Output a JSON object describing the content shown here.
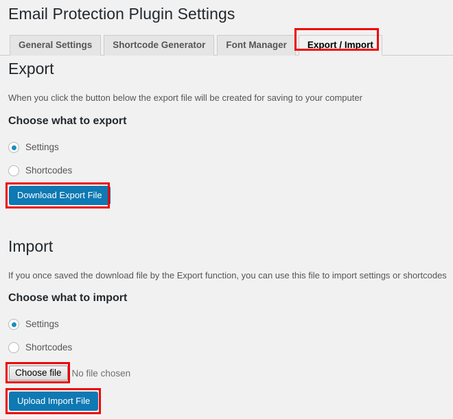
{
  "page": {
    "title": "Email Protection Plugin Settings",
    "background_color": "#f1f1f1"
  },
  "tabs": {
    "items": [
      {
        "label": "General Settings",
        "active": false
      },
      {
        "label": "Shortcode Generator",
        "active": false
      },
      {
        "label": "Font Manager",
        "active": false
      },
      {
        "label": "Export / Import",
        "active": true
      }
    ]
  },
  "export": {
    "heading": "Export",
    "description": "When you click the button below the export file will be created for saving to your computer",
    "subheading": "Choose what to export",
    "options": [
      {
        "label": "Settings",
        "selected": true
      },
      {
        "label": "Shortcodes",
        "selected": false
      }
    ],
    "download_button_label": "Download Export File"
  },
  "import": {
    "heading": "Import",
    "description": "If you once saved the download file by the Export function, you can use this file to import settings or shortcodes",
    "subheading": "Choose what to import",
    "options": [
      {
        "label": "Settings",
        "selected": true
      },
      {
        "label": "Shortcodes",
        "selected": false
      }
    ],
    "file_input": {
      "button_label": "Choose file",
      "status_text": "No file chosen"
    },
    "upload_button_label": "Upload Import File"
  },
  "annotations": {
    "accent_color": "#ee0000",
    "highlighted": [
      "Export / Import",
      "Download Export File",
      "Choose file",
      "Upload Import File"
    ]
  },
  "colors": {
    "primary_button": "#0e79b3",
    "radio_selected": "#1e8cbe",
    "tab_inactive_bg": "#e5e5e5",
    "tab_border": "#cccccc",
    "annotation": "#ee0000"
  }
}
